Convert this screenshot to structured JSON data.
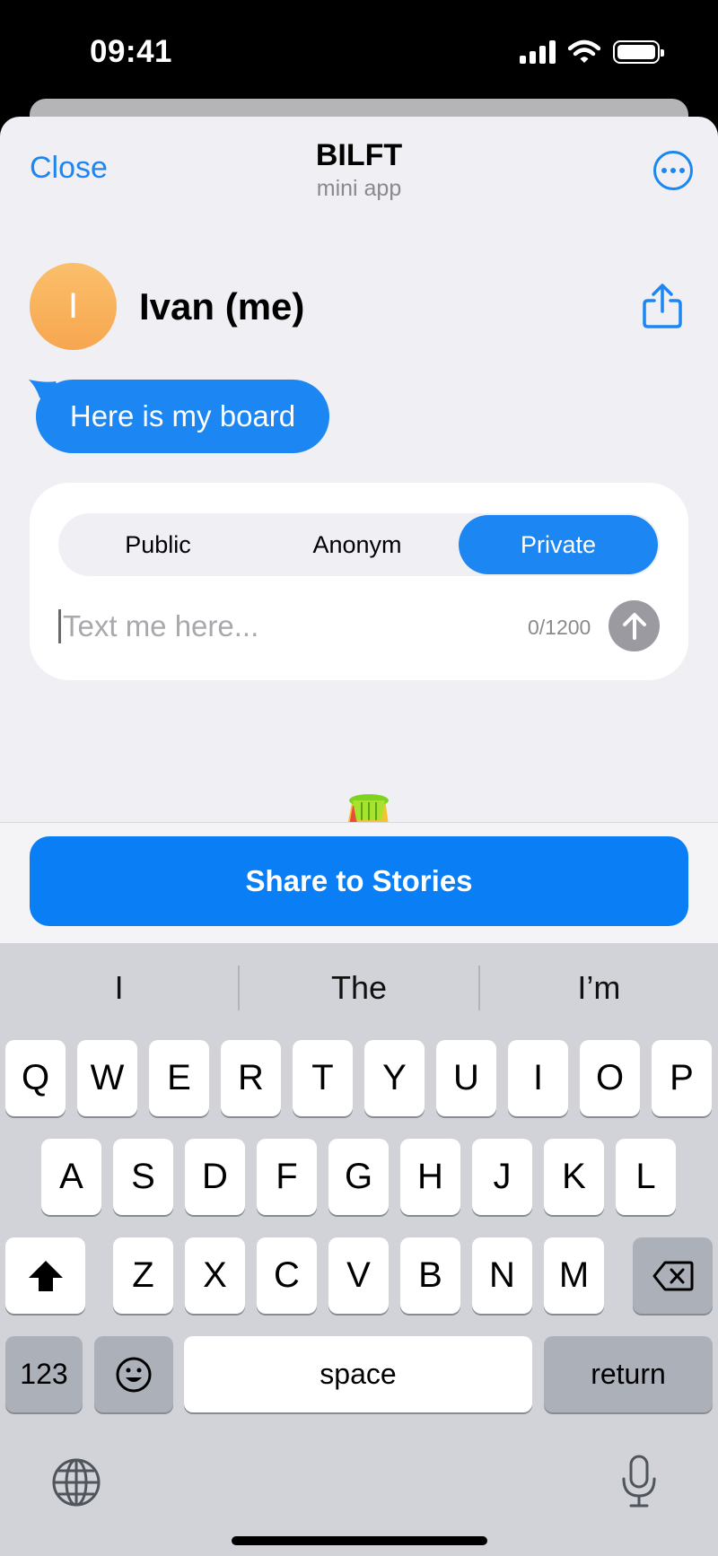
{
  "status_bar": {
    "time": "09:41"
  },
  "nav": {
    "close_label": "Close",
    "title": "BILFT",
    "subtitle": "mini app",
    "more_icon": "ellipsis-circle-icon"
  },
  "user": {
    "avatar_initial": "I",
    "name": "Ivan (me)",
    "share_icon": "share-icon"
  },
  "message": {
    "text": "Here is my board"
  },
  "composer": {
    "tabs": [
      "Public",
      "Anonym",
      "Private"
    ],
    "active_tab": "Private",
    "placeholder": "Text me here...",
    "counter": "0/1200"
  },
  "share_button": "Share to Stories",
  "keyboard": {
    "suggestions": [
      "I",
      "The",
      "I’m"
    ],
    "row1": [
      "Q",
      "W",
      "E",
      "R",
      "T",
      "Y",
      "U",
      "I",
      "O",
      "P"
    ],
    "row2": [
      "A",
      "S",
      "D",
      "F",
      "G",
      "H",
      "J",
      "K",
      "L"
    ],
    "row3": [
      "Z",
      "X",
      "C",
      "V",
      "B",
      "N",
      "M"
    ],
    "numbers_label": "123",
    "space_label": "space",
    "return_label": "return"
  },
  "colors": {
    "accent": "#1c86f2",
    "sheet_background": "#efeff4",
    "keyboard_background": "#d1d3d9"
  }
}
